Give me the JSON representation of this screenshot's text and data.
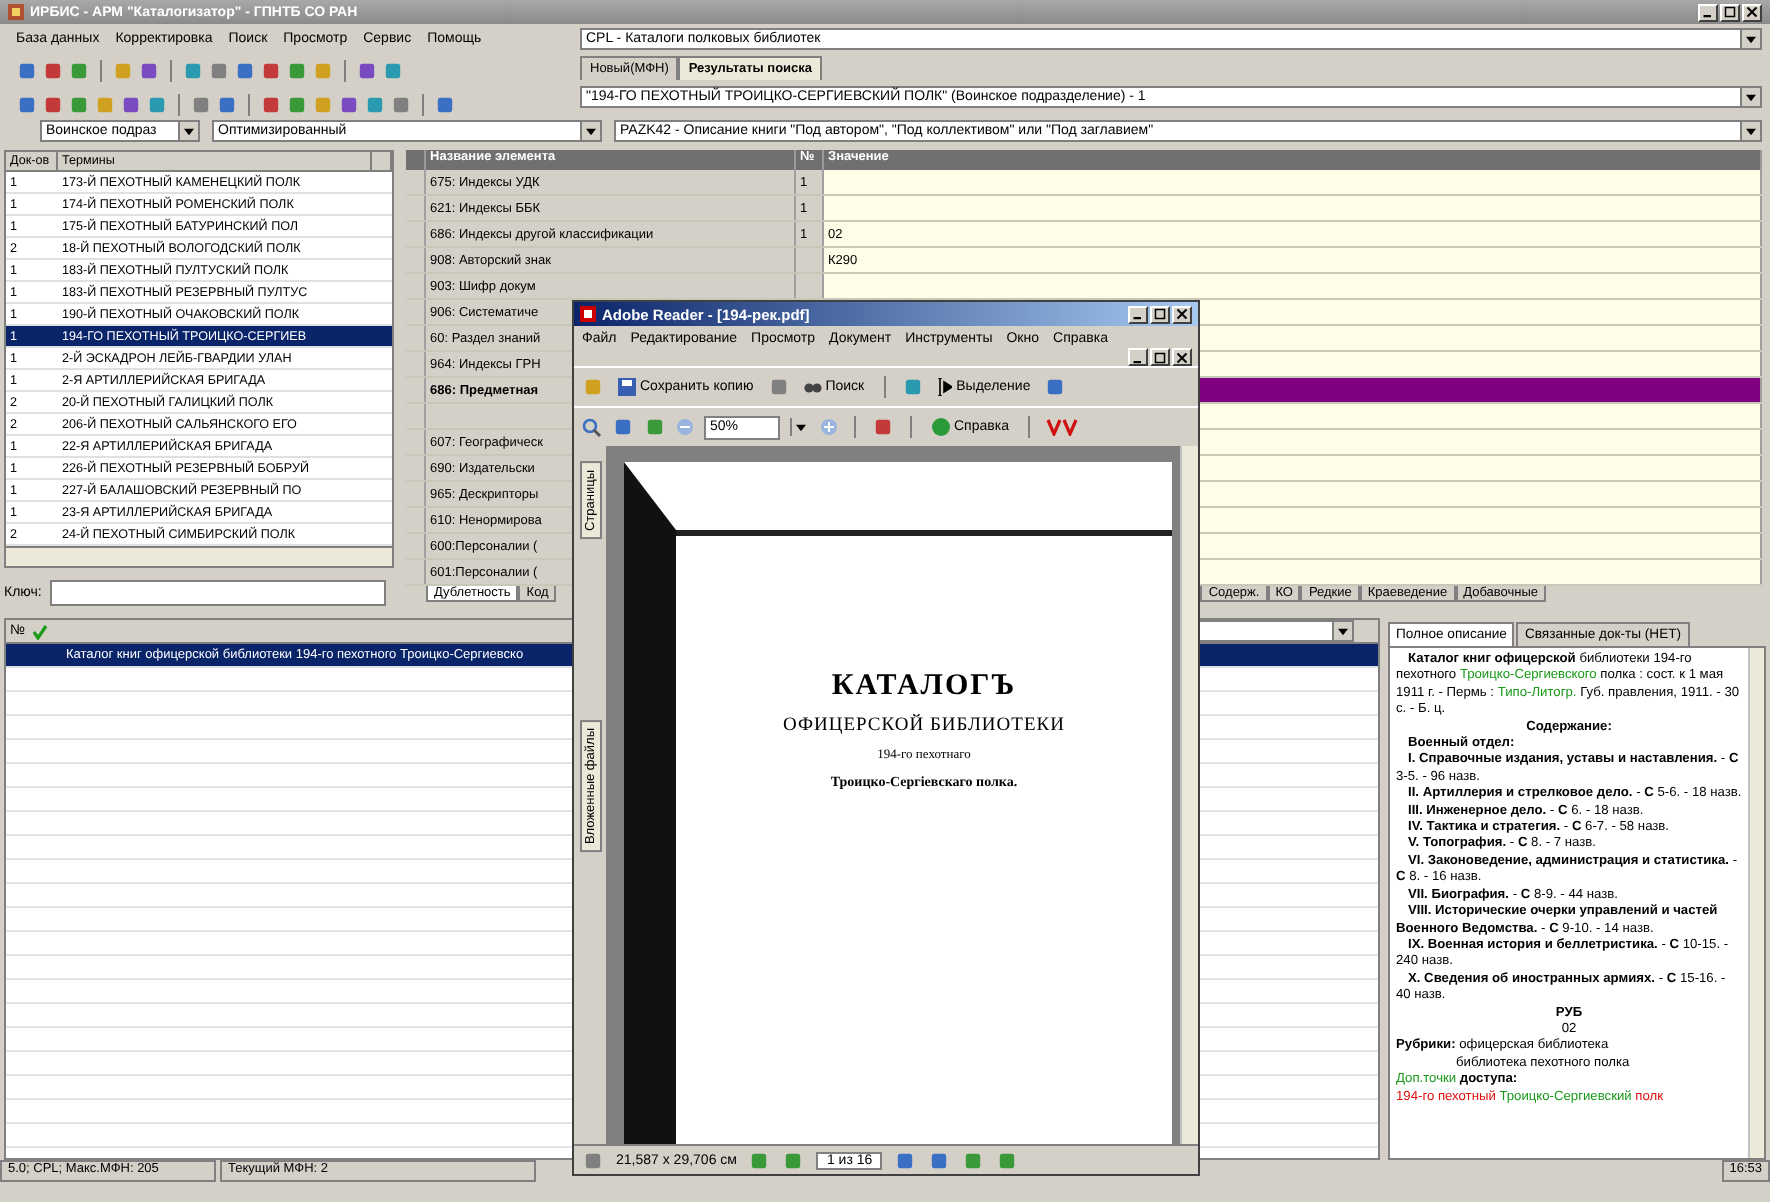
{
  "window": {
    "title": "ИРБИС - АРМ \"Каталогизатор\" - ГПНТБ СО РАН"
  },
  "menu": [
    "База данных",
    "Корректировка",
    "Поиск",
    "Просмотр",
    "Сервис",
    "Помощь"
  ],
  "database": {
    "value": "CPL - Каталоги полковых библиотек"
  },
  "record_tabs": [
    {
      "label": "Новый(МФН)",
      "selected": false
    },
    {
      "label": "Результаты поиска",
      "selected": true
    }
  ],
  "search_result": {
    "value": "\"194-ГО ПЕХОТНЫЙ ТРОИЦКО-СЕРГИЕВСКИЙ ПОЛК\" (Воинское подразделение) - 1"
  },
  "search_prefix": {
    "value": "Воинское подраз"
  },
  "search_mode": {
    "value": "Оптимизированный"
  },
  "worksheet": {
    "value": "PAZK42 - Описание книги \"Под автором\", \"Под коллективом\" или \"Под заглавием\""
  },
  "terms": {
    "columns": [
      "Док-ов",
      "Термины"
    ],
    "rows": [
      {
        "count": "1",
        "term": "173-Й ПЕХОТНЫЙ КАМЕНЕЦКИЙ ПОЛК",
        "selected": false
      },
      {
        "count": "1",
        "term": "174-Й ПЕХОТНЫЙ РОМЕНСКИЙ ПОЛК",
        "selected": false
      },
      {
        "count": "1",
        "term": "175-Й ПЕХОТНЫЙ БАТУРИНСКИЙ ПОЛ",
        "selected": false
      },
      {
        "count": "2",
        "term": "18-Й ПЕХОТНЫЙ ВОЛОГОДСКИЙ ПОЛК",
        "selected": false
      },
      {
        "count": "1",
        "term": "183-Й ПЕХОТНЫЙ ПУЛТУСКИЙ ПОЛК",
        "selected": false
      },
      {
        "count": "1",
        "term": "183-Й ПЕХОТНЫЙ РЕЗЕРВНЫЙ ПУЛТУС",
        "selected": false
      },
      {
        "count": "1",
        "term": "190-Й ПЕХОТНЫЙ ОЧАКОВСКИЙ ПОЛК",
        "selected": false
      },
      {
        "count": "1",
        "term": "194-ГО ПЕХОТНЫЙ ТРОИЦКО-СЕРГИЕВ",
        "selected": true
      },
      {
        "count": "1",
        "term": "2-Й ЭСКАДРОН ЛЕЙБ-ГВАРДИИ УЛАН",
        "selected": false
      },
      {
        "count": "1",
        "term": "2-Я АРТИЛЛЕРИЙСКАЯ БРИГАДА",
        "selected": false
      },
      {
        "count": "2",
        "term": "20-Й ПЕХОТНЫЙ ГАЛИЦКИЙ ПОЛК",
        "selected": false
      },
      {
        "count": "2",
        "term": "206-Й ПЕХОТНЫЙ САЛЬЯНСКОГО ЕГО",
        "selected": false
      },
      {
        "count": "1",
        "term": "22-Я АРТИЛЛЕРИЙСКАЯ БРИГАДА",
        "selected": false
      },
      {
        "count": "1",
        "term": "226-Й ПЕХОТНЫЙ РЕЗЕРВНЫЙ БОБРУЙ",
        "selected": false
      },
      {
        "count": "1",
        "term": "227-Й БАЛАШОВСКИЙ РЕЗЕРВНЫЙ ПО",
        "selected": false
      },
      {
        "count": "1",
        "term": "23-Я АРТИЛЛЕРИЙСКАЯ БРИГАДА",
        "selected": false
      },
      {
        "count": "2",
        "term": "24-Й ПЕХОТНЫЙ СИМБИРСКИЙ ПОЛК",
        "selected": false
      }
    ]
  },
  "key_field": {
    "label": "Ключ:"
  },
  "fields_grid": {
    "columns": [
      "Название элемента",
      "№",
      "Значение"
    ],
    "rows": [
      {
        "name": "675: Индексы УДК",
        "number": "1",
        "selected": false
      },
      {
        "name": "621: Индексы ББК",
        "number": "1",
        "selected": false
      },
      {
        "name": "686: Индексы другой классификации",
        "number": "1",
        "value": "02",
        "selected": false
      },
      {
        "name": "908: Авторский знак",
        "value": "К290",
        "selected": false
      },
      {
        "name": "903: Шифр докум",
        "selected": false
      },
      {
        "name": "906: Систематиче",
        "selected": false
      },
      {
        "name": "60: Раздел знаний",
        "selected": false
      },
      {
        "name": "964: Индексы ГРН",
        "selected": false
      },
      {
        "name": "686: Предметная",
        "selected": true
      },
      {
        "selected": false
      },
      {
        "name": "607: Географическ",
        "selected": false
      },
      {
        "name": "690: Издательски",
        "selected": false
      },
      {
        "name": "965: Дескрипторы",
        "selected": false
      },
      {
        "name": "610: Ненормирова",
        "selected": false
      },
      {
        "name": "600:Персоналии (",
        "selected": false
      },
      {
        "name": "601:Персоналии (",
        "selected": false
      }
    ]
  },
  "grid_tabs": [
    {
      "label": "Дублетность",
      "selected": true
    },
    {
      "label": "Код",
      "selected": false
    },
    {
      "label": "Содерж.",
      "selected": false
    },
    {
      "label": "КО",
      "selected": false
    },
    {
      "label": "Редкие",
      "selected": false
    },
    {
      "label": "Краеведение",
      "selected": false
    },
    {
      "label": "Добавочные",
      "selected": false
    }
  ],
  "results": {
    "columns": [
      "№"
    ],
    "rows": [
      {
        "text": "Каталог книг офицерской библиотеки 194-го пехотного Троицко-Сергиевско",
        "selected": true
      }
    ]
  },
  "description_tabs": [
    {
      "label": "Полное описание",
      "selected": true
    },
    {
      "label": "Связанные док-ты (НЕТ)",
      "selected": false
    }
  ],
  "description": [
    {
      "kind": "lead",
      "segments": [
        {
          "kind": "bold",
          "text": "Каталог книг офицерской"
        },
        {
          "kind": "plain",
          "text": " библиотеки 194-го пехотного "
        },
        {
          "kind": "link",
          "text": "Троицко-Сергиевского"
        },
        {
          "kind": "plain",
          "text": " полка : сост. к 1 мая 1911 г. - Пермь : "
        },
        {
          "kind": "link",
          "text": "Типо-Литогр."
        },
        {
          "kind": "plain",
          "text": " Губ. правления, 1911. - 30 с. - Б. ц."
        }
      ]
    },
    {
      "kind": "centered",
      "segments": [
        {
          "kind": "bold",
          "text": "Содержание:"
        }
      ]
    },
    {
      "kind": "lead",
      "segments": [
        {
          "kind": "bold",
          "text": "Военный отдел:"
        }
      ]
    },
    {
      "kind": "lead",
      "segments": [
        {
          "kind": "bold",
          "text": "I. Справочные издания, уставы и наставления."
        },
        {
          "kind": "plain",
          "text": " - "
        },
        {
          "kind": "bold",
          "text": "С"
        },
        {
          "kind": "plain",
          "text": " 3-5. - 96 назв."
        }
      ]
    },
    {
      "kind": "lead",
      "segments": [
        {
          "kind": "bold",
          "text": "II. Артиллерия и стрелковое дело."
        },
        {
          "kind": "plain",
          "text": " - "
        },
        {
          "kind": "bold",
          "text": "С"
        },
        {
          "kind": "plain",
          "text": " 5-6. - 18 назв."
        }
      ]
    },
    {
      "kind": "lead",
      "segments": [
        {
          "kind": "bold",
          "text": "III. Инженерное дело."
        },
        {
          "kind": "plain",
          "text": " - "
        },
        {
          "kind": "bold",
          "text": "С"
        },
        {
          "kind": "plain",
          "text": " 6. - 18 назв."
        }
      ]
    },
    {
      "kind": "lead",
      "segments": [
        {
          "kind": "bold",
          "text": "IV. Тактика и стратегия."
        },
        {
          "kind": "plain",
          "text": " - "
        },
        {
          "kind": "bold",
          "text": "С"
        },
        {
          "kind": "plain",
          "text": " 6-7. - 58 назв."
        }
      ]
    },
    {
      "kind": "lead",
      "segments": [
        {
          "kind": "bold",
          "text": "V. Топография."
        },
        {
          "kind": "plain",
          "text": " - "
        },
        {
          "kind": "bold",
          "text": "С"
        },
        {
          "kind": "plain",
          "text": " 8. - 7 назв."
        }
      ]
    },
    {
      "kind": "lead",
      "segments": [
        {
          "kind": "bold",
          "text": "VI. Законоведение, администрация и статистика."
        },
        {
          "kind": "plain",
          "text": " - "
        },
        {
          "kind": "bold",
          "text": "С"
        },
        {
          "kind": "plain",
          "text": " 8. - 16 назв."
        }
      ]
    },
    {
      "kind": "lead",
      "segments": [
        {
          "kind": "bold",
          "text": "VII. Биография."
        },
        {
          "kind": "plain",
          "text": " - "
        },
        {
          "kind": "bold",
          "text": "С"
        },
        {
          "kind": "plain",
          "text": " 8-9. - 44 назв."
        }
      ]
    },
    {
      "kind": "lead",
      "segments": [
        {
          "kind": "bold",
          "text": "VIII. Исторические очерки управлений и частей Военного Ведомства."
        },
        {
          "kind": "plain",
          "text": " - "
        },
        {
          "kind": "bold",
          "text": "С"
        },
        {
          "kind": "plain",
          "text": " 9-10. - 14 назв."
        }
      ]
    },
    {
      "kind": "lead",
      "segments": [
        {
          "kind": "bold",
          "text": "IX. Военная история и беллетристика."
        },
        {
          "kind": "plain",
          "text": " - "
        },
        {
          "kind": "bold",
          "text": "С"
        },
        {
          "kind": "plain",
          "text": " 10-15. - 240 назв."
        }
      ]
    },
    {
      "kind": "lead",
      "segments": [
        {
          "kind": "bold",
          "text": "X. Сведения об иностранных армиях."
        },
        {
          "kind": "plain",
          "text": " - "
        },
        {
          "kind": "bold",
          "text": "С"
        },
        {
          "kind": "plain",
          "text": " 15-16. - 40 назв."
        }
      ]
    },
    {
      "kind": "centered",
      "segments": [
        {
          "kind": "bold",
          "text": "РУБ"
        }
      ]
    },
    {
      "kind": "centered",
      "segments": [
        {
          "kind": "plain",
          "text": "02"
        }
      ]
    },
    {
      "kind": "text",
      "segments": [
        {
          "kind": "bold",
          "text": "Рубрики:"
        },
        {
          "kind": "plain",
          "text": " офицерская библиотека"
        }
      ]
    },
    {
      "kind": "indent",
      "segments": [
        {
          "kind": "plain",
          "text": "библиотека пехотного полка"
        }
      ]
    },
    {
      "kind": "text",
      "segments": [
        {
          "kind": "link",
          "text": "Доп.точки"
        },
        {
          "kind": "bold",
          "text": " доступа:"
        }
      ]
    },
    {
      "kind": "text",
      "segments": [
        {
          "kind": "red",
          "text": "194-го пехотный "
        },
        {
          "kind": "link",
          "text": "Троицко-Сергиевский"
        },
        {
          "kind": "red",
          "text": " полк"
        }
      ]
    }
  ],
  "reader": {
    "title": "Adobe Reader - [194-рек.pdf]",
    "menu": [
      "Файл",
      "Редактирование",
      "Просмотр",
      "Документ",
      "Инструменты",
      "Окно",
      "Справка"
    ],
    "save_label": "Сохранить копию",
    "search_label": "Поиск",
    "select_label": "Выделение",
    "zoom": "50%",
    "help_label": "Справка",
    "side_tabs": [
      "Страницы",
      "Вложенные файлы"
    ],
    "document_lines": [
      "КАТАЛОГЪ",
      "ОФИЦЕРСКОЙ БИБЛИОТЕКИ",
      "194-го пехотнаго",
      "Троицко-Сергіевскаго полка."
    ],
    "page_size": "21,587 x 29,706 см",
    "page": "1 из 16"
  },
  "status_bar": [
    "5.0; CPL; Макс.МФН: 205",
    "Текущий МФН: 2",
    "16:53"
  ]
}
